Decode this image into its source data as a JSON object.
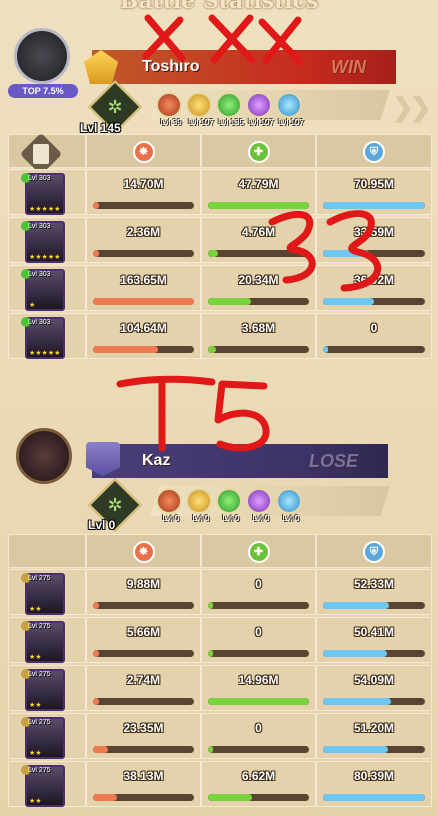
{
  "header": {
    "title": "Battle Statistics"
  },
  "colors": {
    "damage": "#f07a50",
    "heal": "#7ad23e",
    "defense": "#6cc8f0",
    "scrawl": "#e01818"
  },
  "winner": {
    "name": "Toshiro",
    "result": "WIN",
    "rank_badge": "TOP 7.5%",
    "tree_level": "Lvl 145",
    "factions": [
      {
        "icon": "lightbearer-icon",
        "level": "Lvl 39"
      },
      {
        "icon": "mauler-icon",
        "level": "Lvl 107"
      },
      {
        "icon": "wilder-icon",
        "level": "Lvl 135"
      },
      {
        "icon": "graveborn-icon",
        "level": "Lvl 107"
      },
      {
        "icon": "celestial-icon",
        "level": "Lvl 107"
      }
    ],
    "heroes": [
      {
        "level": "Lvl 303",
        "stars": "★★★★★",
        "damage": "14.70M",
        "damage_pct": 0.06,
        "heal": "47.79M",
        "heal_pct": 1.0,
        "defense": "70.95M",
        "defense_pct": 1.0
      },
      {
        "level": "Lvl 303",
        "stars": "★★★★★",
        "damage": "2.36M",
        "damage_pct": 0.02,
        "heal": "4.76M",
        "heal_pct": 0.1,
        "defense": "33.59M",
        "defense_pct": 0.45
      },
      {
        "level": "Lvl 303",
        "stars": "★",
        "damage": "163.65M",
        "damage_pct": 1.0,
        "heal": "20.34M",
        "heal_pct": 0.43,
        "defense": "36.02M",
        "defense_pct": 0.5
      },
      {
        "level": "Lvl 303",
        "stars": "★★★★★",
        "damage": "104.64M",
        "damage_pct": 0.64,
        "heal": "3.68M",
        "heal_pct": 0.08,
        "defense": "0",
        "defense_pct": 0.0
      }
    ]
  },
  "loser": {
    "name": "Kaz",
    "result": "LOSE",
    "tree_level": "Lvl 0",
    "factions": [
      {
        "icon": "lightbearer-icon",
        "level": "Lvl 0"
      },
      {
        "icon": "mauler-icon",
        "level": "Lvl 0"
      },
      {
        "icon": "wilder-icon",
        "level": "Lvl 0"
      },
      {
        "icon": "graveborn-icon",
        "level": "Lvl 0"
      },
      {
        "icon": "celestial-icon",
        "level": "Lvl 0"
      }
    ],
    "heroes": [
      {
        "level": "Lvl 275",
        "stars": "★★",
        "damage": "9.88M",
        "damage_pct": 0.06,
        "heal": "0",
        "heal_pct": 0.0,
        "defense": "52.33M",
        "defense_pct": 0.65
      },
      {
        "level": "Lvl 275",
        "stars": "★★",
        "damage": "5.66M",
        "damage_pct": 0.04,
        "heal": "0",
        "heal_pct": 0.0,
        "defense": "50.41M",
        "defense_pct": 0.63
      },
      {
        "level": "Lvl 275",
        "stars": "★★",
        "damage": "2.74M",
        "damage_pct": 0.02,
        "heal": "14.96M",
        "heal_pct": 1.0,
        "defense": "54.09M",
        "defense_pct": 0.67
      },
      {
        "level": "Lvl 275",
        "stars": "★★",
        "damage": "23.35M",
        "damage_pct": 0.15,
        "heal": "0",
        "heal_pct": 0.0,
        "defense": "51.20M",
        "defense_pct": 0.64
      },
      {
        "level": "Lvl 275",
        "stars": "★★",
        "damage": "38.13M",
        "damage_pct": 0.24,
        "heal": "6.62M",
        "heal_pct": 0.44,
        "defense": "80.39M",
        "defense_pct": 1.0
      }
    ]
  }
}
